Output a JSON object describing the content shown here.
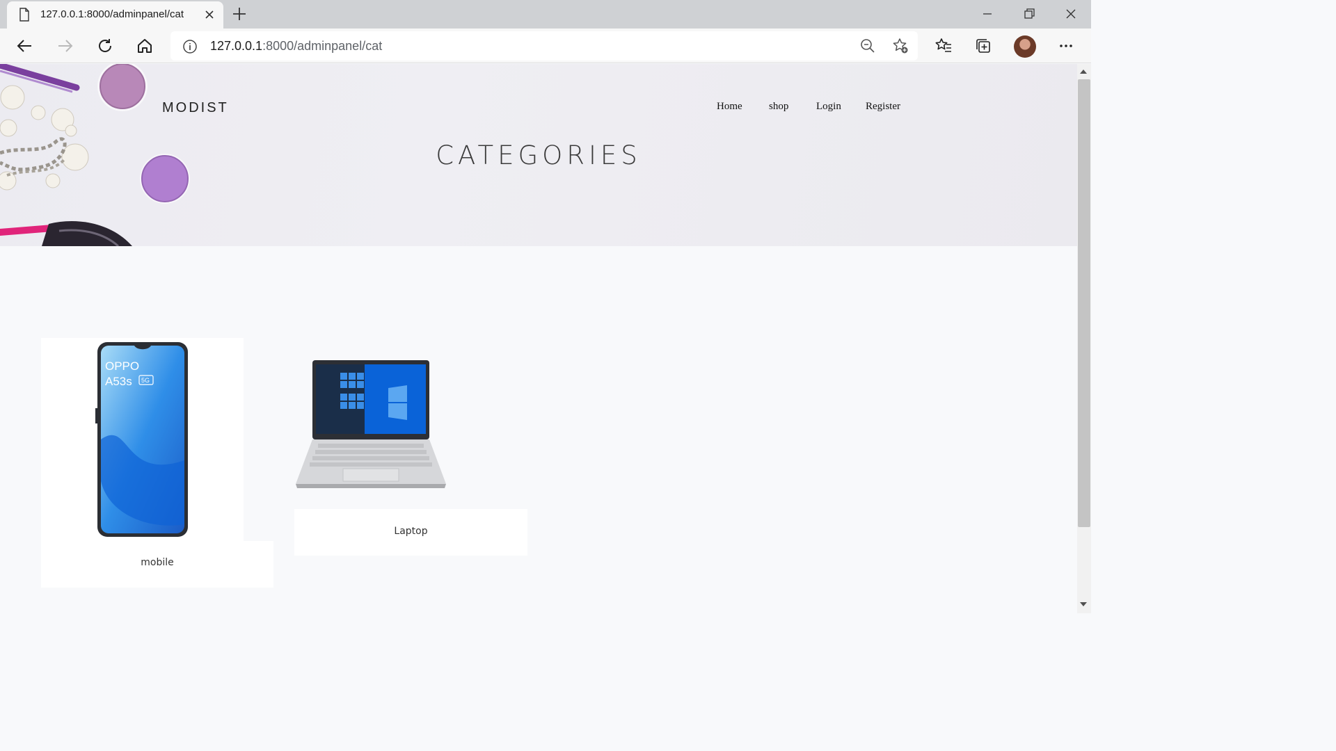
{
  "browser": {
    "tab_title": "127.0.0.1:8000/adminpanel/cat",
    "url_host": "127.0.0.1",
    "url_rest": ":8000/adminpanel/cat"
  },
  "site": {
    "brand": "MODIST",
    "nav": [
      "Home",
      "shop",
      "Login",
      "Register"
    ],
    "page_title": "CATEGORIES"
  },
  "categories": [
    {
      "name": "mobile",
      "image": "phone-image"
    },
    {
      "name": "Laptop",
      "image": "laptop-image"
    }
  ],
  "colors": {
    "hero_bg": "#ecebf1",
    "accent_purple": "#b07fc7",
    "page_bg": "#f8f9fb"
  }
}
